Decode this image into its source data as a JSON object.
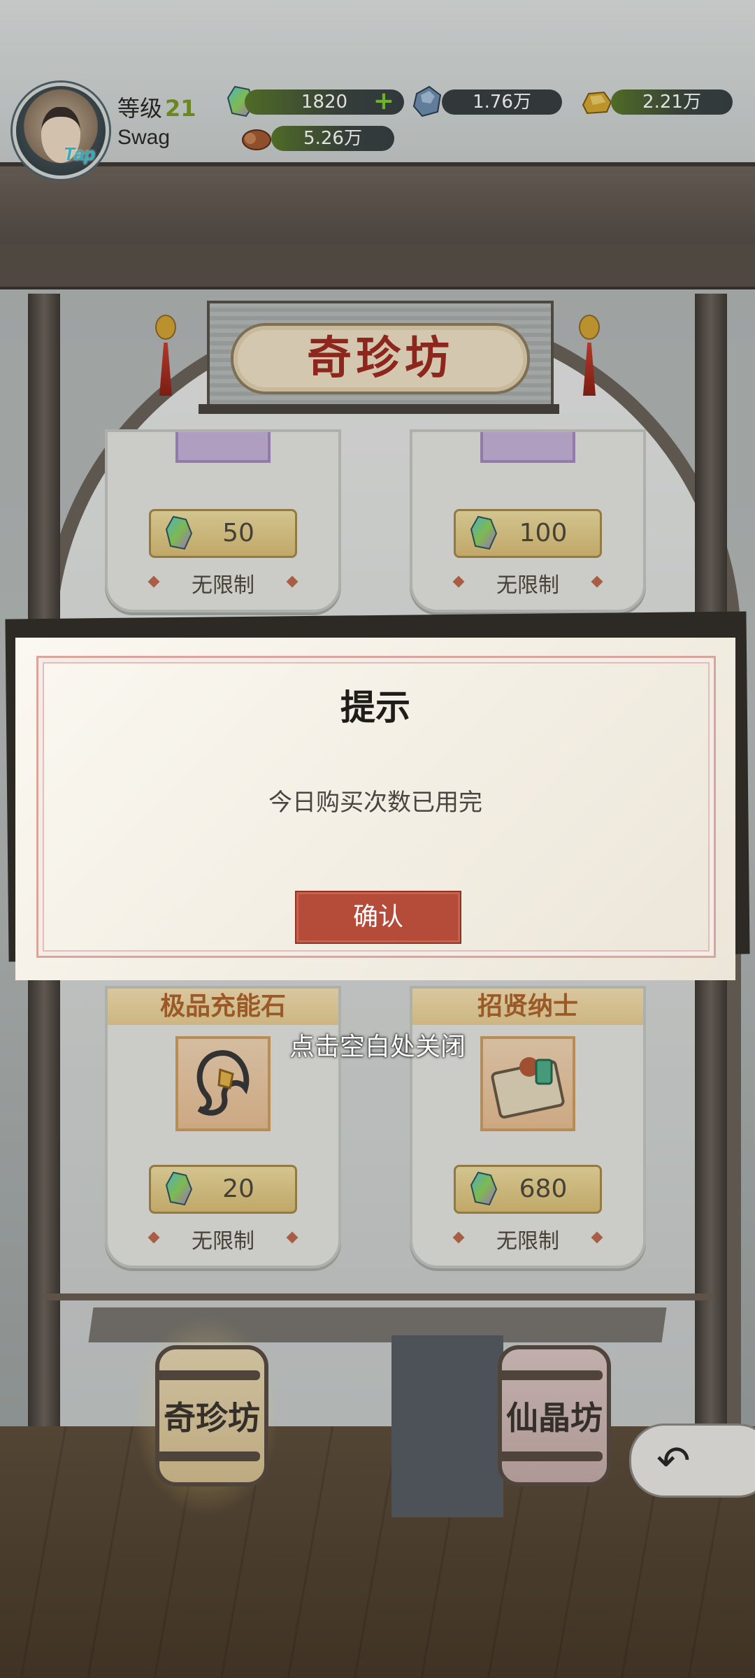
{
  "player": {
    "level_label": "等级",
    "level": "21",
    "name": "Swag",
    "avatar_badge": "Tap"
  },
  "resources": [
    {
      "icon": "rainbow-crystal-icon",
      "value": "1820",
      "has_plus": true
    },
    {
      "icon": "blue-stone-icon",
      "value": "1.76万"
    },
    {
      "icon": "gold-ingot-icon",
      "value": "2.21万"
    },
    {
      "icon": "wood-log-icon",
      "value": "5.26万"
    }
  ],
  "shop": {
    "title": "奇珍坊",
    "cards": [
      {
        "name": "",
        "price": "50",
        "limit": "无限制"
      },
      {
        "name": "",
        "price": "100",
        "limit": "无限制"
      },
      {
        "name": "极品充能石",
        "price": "20",
        "limit": "无限制",
        "icon": "charge-stone-icon"
      },
      {
        "name": "招贤纳士",
        "price": "680",
        "limit": "无限制",
        "icon": "recruit-scroll-icon"
      }
    ]
  },
  "dialog": {
    "title": "提示",
    "message": "今日购买次数已用完",
    "confirm_label": "确认",
    "close_hint": "点击空白处关闭"
  },
  "nav": {
    "tab_left": "奇珍坊",
    "tab_right": "仙晶坊",
    "back_icon": "back-arrow-icon"
  },
  "colors": {
    "confirm_button": "#b54c3a",
    "level_number": "#7c9a25",
    "price_tag": "#e6cf8c"
  }
}
